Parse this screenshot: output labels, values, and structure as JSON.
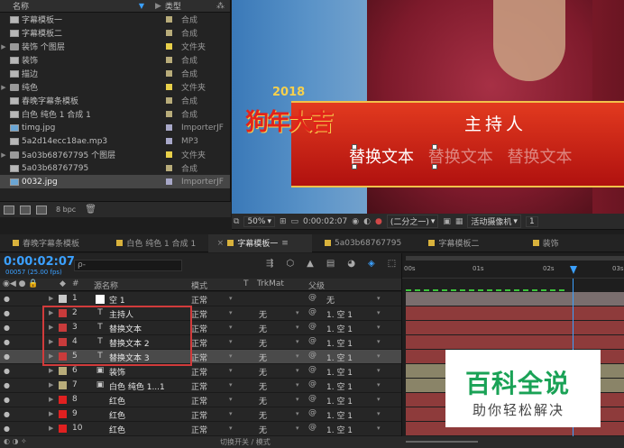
{
  "project": {
    "col_name": "名称",
    "col_type": "类型",
    "items": [
      {
        "name": "字幕模板一",
        "type": "合成",
        "icon": "comp",
        "swatch": "#b8ac7a",
        "arrow": ""
      },
      {
        "name": "字幕模板二",
        "type": "合成",
        "icon": "comp",
        "swatch": "#b8ac7a",
        "arrow": ""
      },
      {
        "name": "装饰 个图层",
        "type": "文件夹",
        "icon": "folder",
        "swatch": "#e8d04a",
        "arrow": "▶"
      },
      {
        "name": "装饰",
        "type": "合成",
        "icon": "comp",
        "swatch": "#b8ac7a",
        "arrow": ""
      },
      {
        "name": "描边",
        "type": "合成",
        "icon": "comp",
        "swatch": "#b8ac7a",
        "arrow": ""
      },
      {
        "name": "纯色",
        "type": "文件夹",
        "icon": "folder",
        "swatch": "#e8d04a",
        "arrow": "▶"
      },
      {
        "name": "春晚字幕条模板",
        "type": "合成",
        "icon": "comp",
        "swatch": "#b8ac7a",
        "arrow": ""
      },
      {
        "name": "白色 纯色 1 合成 1",
        "type": "合成",
        "icon": "comp",
        "swatch": "#b8ac7a",
        "arrow": ""
      },
      {
        "name": "timg.jpg",
        "type": "ImporterJF",
        "icon": "image",
        "swatch": "#a8a8c8",
        "arrow": ""
      },
      {
        "name": "5a2d14ecc18ae.mp3",
        "type": "MP3",
        "icon": "audio",
        "swatch": "#a8a8c8",
        "arrow": ""
      },
      {
        "name": "5a03b68767795 个图层",
        "type": "文件夹",
        "icon": "folder",
        "swatch": "#e8d04a",
        "arrow": "▶"
      },
      {
        "name": "5a03b68767795",
        "type": "合成",
        "icon": "comp",
        "swatch": "#b8ac7a",
        "arrow": ""
      },
      {
        "name": "0032.jpg",
        "type": "ImporterJF",
        "icon": "image",
        "swatch": "#a8a8c8",
        "arrow": "",
        "selected": true
      }
    ],
    "bpc": "8 bpc"
  },
  "viewer": {
    "logo_year": "2018",
    "logo_text": "狗年大吉",
    "title": "主持人",
    "subs": [
      "替换文本",
      "替换文本",
      "替换文本"
    ],
    "zoom": "50%",
    "timecode": "0:00:02:07",
    "resolution": "(二分之一)",
    "camera": "活动摄像机",
    "views": "1"
  },
  "tabs": [
    {
      "label": "春晚字幕条模板",
      "active": false
    },
    {
      "label": "白色 纯色 1 合成 1",
      "active": false
    },
    {
      "label": "字幕模板一",
      "active": true
    },
    {
      "label": "5a03b68767795",
      "active": false
    },
    {
      "label": "字幕模板二",
      "active": false
    },
    {
      "label": "装饰",
      "active": false
    }
  ],
  "timeline": {
    "timecode": "0:00:02:07",
    "fps": "00057 (25.00 fps)",
    "search_placeholder": "ρ-",
    "col_hash": "#",
    "col_source": "源名称",
    "col_mode": "模式",
    "col_t": "T",
    "col_trk": "TrkMat",
    "col_parent": "父级",
    "ruler": [
      "00s",
      "01s",
      "02s",
      "03s"
    ],
    "layers": [
      {
        "num": "1",
        "kind": "",
        "name": "空 1",
        "mode": "正常",
        "trk": "",
        "parent": "无",
        "color": "#c8c8c8",
        "white": true
      },
      {
        "num": "2",
        "kind": "T",
        "name": "主持人",
        "mode": "正常",
        "trk": "无",
        "parent": "1. 空 1",
        "color": "#c83b3b"
      },
      {
        "num": "3",
        "kind": "T",
        "name": "替换文本",
        "mode": "正常",
        "trk": "无",
        "parent": "1. 空 1",
        "color": "#c83b3b"
      },
      {
        "num": "4",
        "kind": "T",
        "name": "替换文本 2",
        "mode": "正常",
        "trk": "无",
        "parent": "1. 空 1",
        "color": "#c83b3b"
      },
      {
        "num": "5",
        "kind": "T",
        "name": "替换文本 3",
        "mode": "正常",
        "trk": "无",
        "parent": "1. 空 1",
        "color": "#c83b3b",
        "selected": true
      },
      {
        "num": "6",
        "kind": "▣",
        "name": "装饰",
        "mode": "正常",
        "trk": "无",
        "parent": "1. 空 1",
        "color": "#b8ac7a"
      },
      {
        "num": "7",
        "kind": "▣",
        "name": "白色 纯色 1...1",
        "mode": "正常",
        "trk": "无",
        "parent": "1. 空 1",
        "color": "#b8ac7a"
      },
      {
        "num": "8",
        "kind": "",
        "name": "红色",
        "mode": "正常",
        "trk": "无",
        "parent": "1. 空 1",
        "color": "#e02020"
      },
      {
        "num": "9",
        "kind": "",
        "name": "红色",
        "mode": "正常",
        "trk": "无",
        "parent": "1. 空 1",
        "color": "#e02020"
      },
      {
        "num": "10",
        "kind": "",
        "name": "红色",
        "mode": "正常",
        "trk": "无",
        "parent": "1. 空 1",
        "color": "#e02020"
      }
    ],
    "footer": "切换开关 / 模式"
  },
  "watermark": {
    "big": "百科全说",
    "small": "助你轻松解决"
  }
}
